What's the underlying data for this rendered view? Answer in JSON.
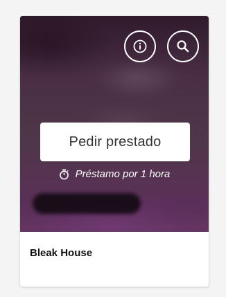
{
  "book": {
    "title": "Bleak House"
  },
  "actions": {
    "borrow_label": "Pedir prestado",
    "loan_duration": "Préstamo por 1 hora",
    "info_icon": "info-icon",
    "search_icon": "search-icon",
    "timer_icon": "stopwatch-icon"
  },
  "colors": {
    "cover_overlay": "#4a2e44",
    "button_bg": "#ffffff",
    "text": "#333333"
  }
}
